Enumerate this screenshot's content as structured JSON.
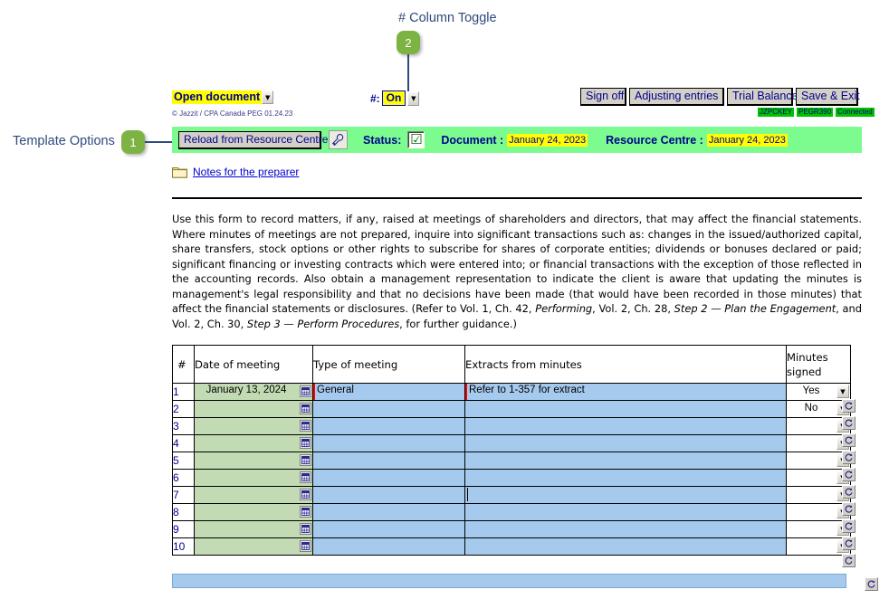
{
  "annotations": [
    {
      "id": "1",
      "label": "Template Options",
      "badge": "1"
    },
    {
      "id": "2",
      "label": "# Column Toggle",
      "badge": "2"
    }
  ],
  "toolbar": {
    "open_document_label": "Open document",
    "copyright": "© Jazzit / CPA Canada PEG 01.24.23",
    "hash_label": "#:",
    "hash_value": "On",
    "buttons": [
      {
        "label": "Sign off",
        "name": "sign-off-button"
      },
      {
        "label": "Adjusting entries",
        "name": "adjusting-entries-button"
      },
      {
        "label": "Trial Balance",
        "name": "trial-balance-button"
      },
      {
        "label": "Save & Exit",
        "name": "save-exit-button"
      }
    ],
    "badges": [
      "JZPCKEY",
      "PEGR390",
      "Connected"
    ]
  },
  "statusbar": {
    "reload_label": "Reload from Resource Centre",
    "wrench_icon": "wrench-icon",
    "status_label": "Status:",
    "status_checked": "☑",
    "document_label": "Document :",
    "document_date": "January 24, 2023",
    "resource_label": "Resource Centre :",
    "resource_date": "January 24, 2023"
  },
  "notes": {
    "link_label": "Notes for the preparer",
    "folder_icon": "folder-icon"
  },
  "body_text": {
    "paragraph_html": "Use this form to record matters, if any, raised at meetings of shareholders and directors, that may affect the financial statements. Where minutes of meetings are not prepared, inquire into significant transactions such as: changes in the issued/authorized capital, share transfers, stock options or other rights to subscribe for shares of corporate entities; dividends or bonuses declared or paid; significant financing or investing contracts which were entered into; or financial transactions with the exception of those reflected in the accounting records. Also obtain a management representation to indicate the client is aware that updating the minutes is management's legal responsibility and that no decisions have been made (that would have been recorded in those minutes) that affect the financial statements or disclosures. (Refer to Vol. 1, Ch. 42, <i>Performing</i>, Vol. 2, Ch. 28, <i>Step 2 — Plan the Engagement</i>, and Vol. 2, Ch. 30, <i>Step 3 — Perform Procedures</i>, for further guidance.)"
  },
  "table": {
    "headers": {
      "num": "#",
      "date": "Date of meeting",
      "type": "Type of meeting",
      "extracts": "Extracts from minutes",
      "minutes_line1": "Minutes",
      "minutes_line2": "signed"
    },
    "rows": [
      {
        "num": "1",
        "date": "January 13, 2024",
        "type": "General",
        "extracts": "Refer to 1-357 for extract",
        "signed": "Yes"
      },
      {
        "num": "2",
        "date": "",
        "type": "",
        "extracts": "",
        "signed": "No"
      },
      {
        "num": "3",
        "date": "",
        "type": "",
        "extracts": "",
        "signed": ""
      },
      {
        "num": "4",
        "date": "",
        "type": "",
        "extracts": "",
        "signed": ""
      },
      {
        "num": "5",
        "date": "",
        "type": "",
        "extracts": "",
        "signed": ""
      },
      {
        "num": "6",
        "date": "",
        "type": "",
        "extracts": "",
        "signed": ""
      },
      {
        "num": "7",
        "date": "",
        "type": "",
        "extracts": "",
        "signed": ""
      },
      {
        "num": "8",
        "date": "",
        "type": "",
        "extracts": "",
        "signed": ""
      },
      {
        "num": "9",
        "date": "",
        "type": "",
        "extracts": "",
        "signed": ""
      },
      {
        "num": "10",
        "date": "",
        "type": "",
        "extracts": "",
        "signed": ""
      }
    ]
  },
  "colors": {
    "green_band": "#7cfc8e",
    "yellow_highlight": "#ffff00",
    "blue_cell": "#a6caee",
    "green_cell": "#c3dbb4",
    "callout_green": "#7cb342",
    "link_blue": "#0000cd",
    "badge_green": "#00c000"
  }
}
